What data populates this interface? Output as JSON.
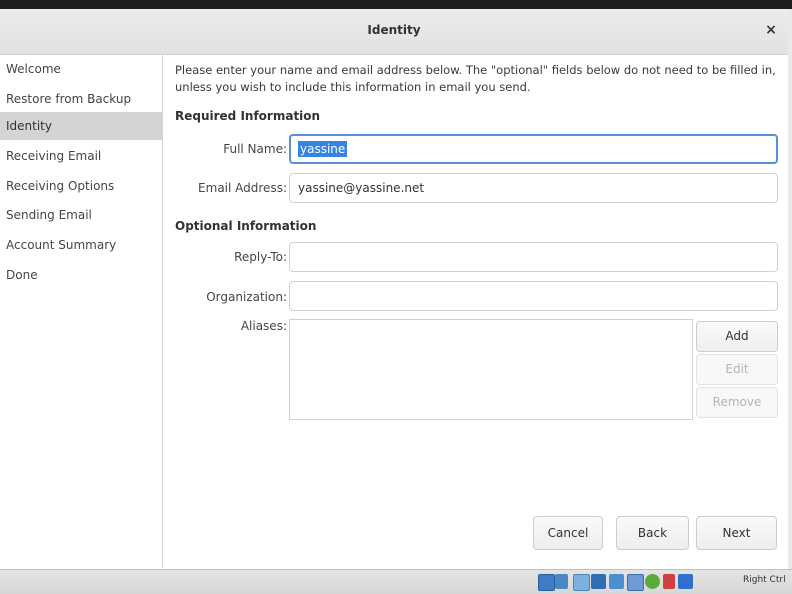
{
  "window": {
    "title": "Identity",
    "close_glyph": "×"
  },
  "sidebar": {
    "items": [
      {
        "label": "Welcome"
      },
      {
        "label": "Restore from Backup"
      },
      {
        "label": "Identity",
        "active": true
      },
      {
        "label": "Receiving Email"
      },
      {
        "label": "Receiving Options"
      },
      {
        "label": "Sending Email"
      },
      {
        "label": "Account Summary"
      },
      {
        "label": "Done"
      }
    ]
  },
  "main": {
    "intro": "Please enter your name and email address below. The \"optional\" fields below do not need to be filled in, unless you wish to include this information in email you send.",
    "required_heading": "Required Information",
    "optional_heading": "Optional Information",
    "full_name": {
      "label": "Full Name:",
      "value": "yassine"
    },
    "email": {
      "label": "Email Address:",
      "value": "yassine@yassine.net"
    },
    "reply_to": {
      "label": "Reply-To:",
      "value": ""
    },
    "organization": {
      "label": "Organization:",
      "value": ""
    },
    "aliases": {
      "label": "Aliases:",
      "add_label": "Add",
      "edit_label": "Edit",
      "remove_label": "Remove"
    }
  },
  "buttons": {
    "cancel": "Cancel",
    "back": "Back",
    "next": "Next"
  },
  "statusbar": {
    "host_key": "Right Ctrl",
    "icons": [
      "hard-disk-icon",
      "optical-drive-icon",
      "usb-icon",
      "shared-folder-icon",
      "display-icon",
      "recording-icon",
      "network-icon",
      "mouse-integration-icon",
      "download-arrow-icon"
    ]
  },
  "colors": {
    "selection": "#3584e4",
    "focus_border": "#5a8fd6",
    "sidebar_active": "#d4d4d4"
  }
}
